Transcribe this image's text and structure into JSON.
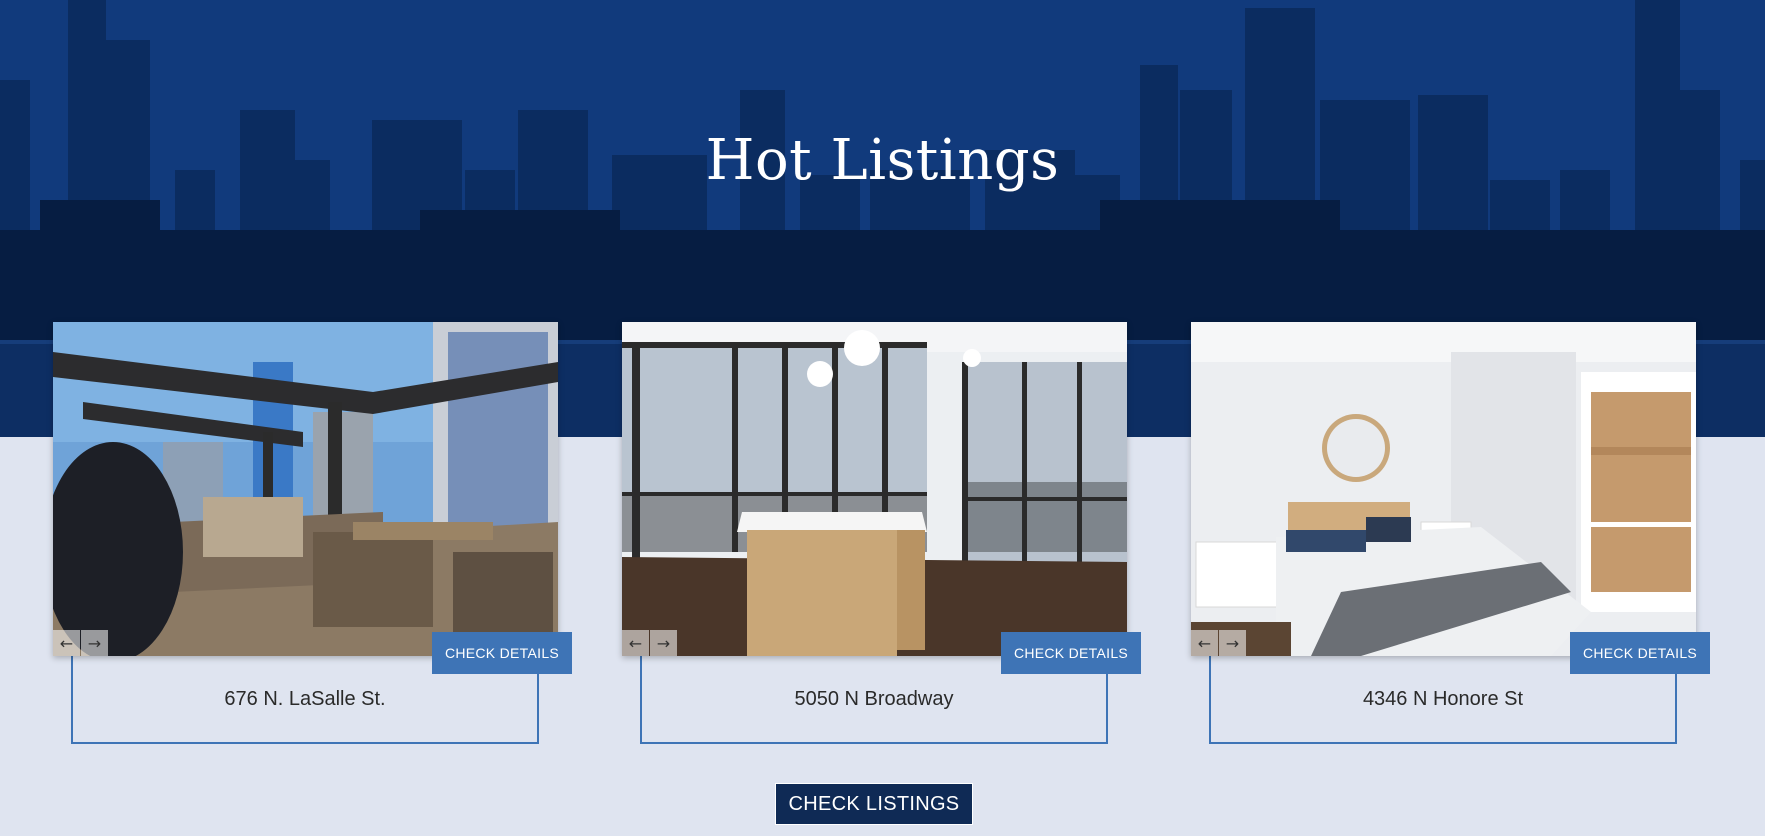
{
  "hero": {
    "title": "Hot Listings"
  },
  "listings": [
    {
      "address": "676 N. LaSalle St.",
      "details_label": "CHECK DETAILS",
      "photo_icon": "rooftop-terrace-photo"
    },
    {
      "address": "5050 N Broadway",
      "details_label": "CHECK DETAILS",
      "photo_icon": "kitchen-interior-photo"
    },
    {
      "address": "4346 N Honore St",
      "details_label": "CHECK DETAILS",
      "photo_icon": "bedroom-interior-photo"
    }
  ],
  "carousel": {
    "prev_icon": "←",
    "next_icon": "→"
  },
  "cta": {
    "label": "CHECK LISTINGS"
  },
  "colors": {
    "accent": "#3e74b6",
    "hero_bg": "#123e84",
    "cta_bg": "#0f2a55",
    "page_bg": "#dfe4f0"
  }
}
